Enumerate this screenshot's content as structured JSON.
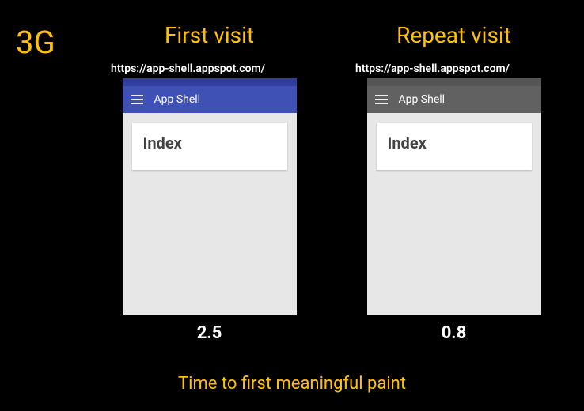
{
  "network_badge": "3G",
  "caption": "Time to first meaningful paint",
  "columns": {
    "first": {
      "title": "First visit",
      "url": "https://app-shell.appspot.com/",
      "app_title": "App Shell",
      "card_title": "Index",
      "timing": "2.5",
      "bar_variant": "blue"
    },
    "repeat": {
      "title": "Repeat visit",
      "url": "https://app-shell.appspot.com/",
      "app_title": "App Shell",
      "card_title": "Index",
      "timing": "0.8",
      "bar_variant": "grey"
    }
  }
}
